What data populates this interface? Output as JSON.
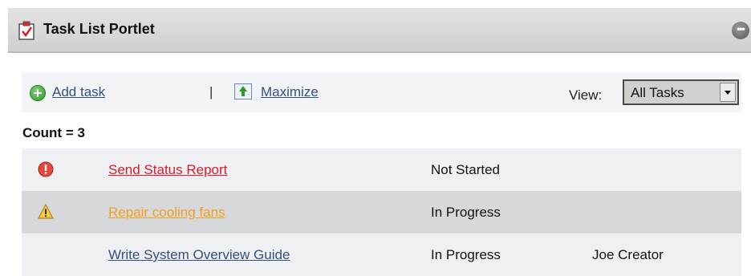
{
  "portlet": {
    "title": "Task List Portlet"
  },
  "toolbar": {
    "add_label": "Add task",
    "separator": "|",
    "maximize_label": "Maximize",
    "view_label": "View:",
    "view_selected": "All Tasks"
  },
  "count_text": "Count = 3",
  "tasks": [
    {
      "name": "Send Status Report",
      "status": "Not Started",
      "owner": "",
      "priority": "high",
      "icon": "error-icon",
      "link_color": "#e0192a"
    },
    {
      "name": "Repair cooling fans",
      "status": "In Progress",
      "owner": "",
      "priority": "medium",
      "icon": "warning-icon",
      "link_color": "#f0a020"
    },
    {
      "name": "Write System Overview Guide",
      "status": "In Progress",
      "owner": "Joe Creator",
      "priority": "normal",
      "icon": "",
      "link_color": "#33517f"
    }
  ],
  "colors": {
    "header_bg": "#d8d8d8",
    "link": "#33517f",
    "row_alt": "#d6d8dc",
    "row": "#eef0f4"
  }
}
